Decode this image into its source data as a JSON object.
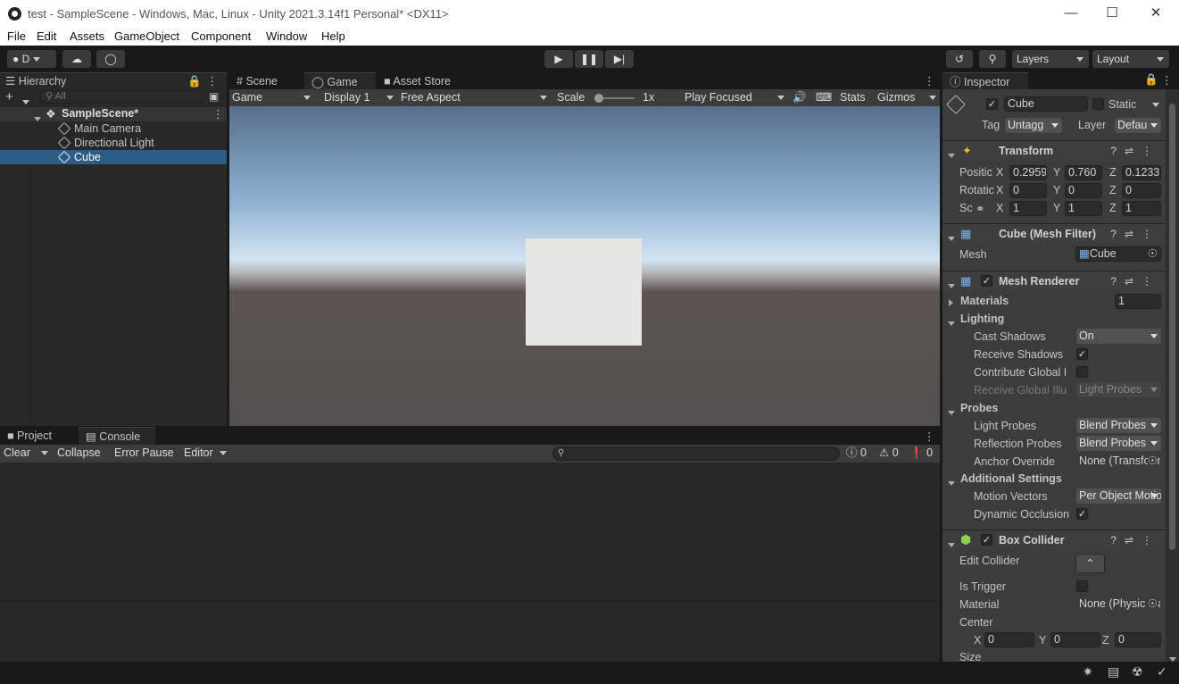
{
  "window": {
    "title": "test - SampleScene - Windows, Mac, Linux - Unity 2021.3.14f1 Personal* <DX11>"
  },
  "menu": [
    "File",
    "Edit",
    "Assets",
    "GameObject",
    "Component",
    "Window",
    "Help"
  ],
  "toolbar": {
    "account": "D",
    "layers": "Layers",
    "layout": "Layout"
  },
  "hierarchy": {
    "tab": "Hierarchy",
    "search_placeholder": "All",
    "scene": "SampleScene*",
    "items": [
      "Main Camera",
      "Directional Light",
      "Cube"
    ],
    "selected": "Cube"
  },
  "center_tabs": [
    "Scene",
    "Game",
    "Asset Store"
  ],
  "game_toolbar": {
    "mode": "Game",
    "display": "Display 1",
    "aspect": "Free Aspect",
    "scale_label": "Scale",
    "scale_value": "1x",
    "play_mode": "Play Focused",
    "stats": "Stats",
    "gizmos": "Gizmos"
  },
  "bottom_tabs": [
    "Project",
    "Console"
  ],
  "console_toolbar": {
    "clear": "Clear",
    "collapse": "Collapse",
    "error_pause": "Error Pause",
    "editor": "Editor",
    "count_log": "0",
    "count_warn": "0",
    "count_error": "0"
  },
  "inspector": {
    "tab": "Inspector",
    "object_name": "Cube",
    "static_label": "Static",
    "tag_label": "Tag",
    "tag_value": "Untagg",
    "layer_label": "Layer",
    "layer_value": "Defau",
    "transform": {
      "title": "Transform",
      "position_label": "Positic",
      "rotation_label": "Rotatic",
      "scale_label": "Sc",
      "position": [
        "0.2959",
        "0.760",
        "0.1233"
      ],
      "rotation": [
        "0",
        "0",
        "0"
      ],
      "scale": [
        "1",
        "1",
        "1"
      ]
    },
    "mesh_filter": {
      "title": "Cube (Mesh Filter)",
      "mesh_label": "Mesh",
      "mesh_value": "Cube"
    },
    "mesh_renderer": {
      "title": "Mesh Renderer",
      "materials_label": "Materials",
      "materials_count": "1",
      "lighting_label": "Lighting",
      "cast_shadows_label": "Cast Shadows",
      "cast_shadows_value": "On",
      "receive_shadows_label": "Receive Shadows",
      "contribute_gi_label": "Contribute Global I",
      "receive_gi_label": "Receive Global Illu",
      "receive_gi_value": "Light Probes",
      "probes_label": "Probes",
      "light_probes_label": "Light Probes",
      "light_probes_value": "Blend Probes",
      "reflection_probes_label": "Reflection Probes",
      "reflection_probes_value": "Blend Probes",
      "anchor_override_label": "Anchor Override",
      "anchor_override_value": "None (Transform)",
      "additional_label": "Additional Settings",
      "motion_vectors_label": "Motion Vectors",
      "motion_vectors_value": "Per Object Motion",
      "dynamic_occlusion_label": "Dynamic Occlusion"
    },
    "box_collider": {
      "title": "Box Collider",
      "edit_collider_label": "Edit Collider",
      "is_trigger_label": "Is Trigger",
      "material_label": "Material",
      "material_value": "None (Physic Material)",
      "center_label": "Center",
      "center": [
        "0",
        "0",
        "0"
      ],
      "size_label": "Size"
    }
  },
  "axes": [
    "X",
    "Y",
    "Z"
  ]
}
